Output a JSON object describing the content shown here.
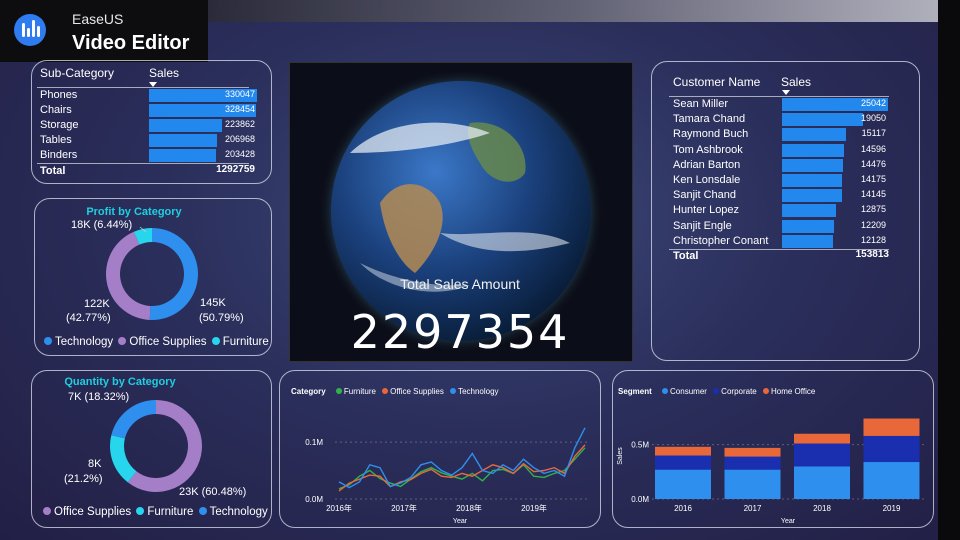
{
  "watermark": {
    "brand": "EaseUS",
    "app": "Video Editor"
  },
  "subcategory_table": {
    "col1": "Sub-Category",
    "col2": "Sales",
    "rows": [
      {
        "name": "Phones",
        "value": 330047
      },
      {
        "name": "Chairs",
        "value": 328454
      },
      {
        "name": "Storage",
        "value": 223862
      },
      {
        "name": "Tables",
        "value": 206968
      },
      {
        "name": "Binders",
        "value": 203428
      }
    ],
    "total_label": "Total",
    "total_value": "1292759"
  },
  "profit_by_category": {
    "title": "Profit by Category",
    "labels": {
      "furniture": "18K (6.44%)",
      "office_l1": "122K",
      "office_l2": "(42.77%)",
      "tech_l1": "145K",
      "tech_l2": "(50.79%)"
    },
    "legend": [
      "Technology",
      "Office Supplies",
      "Furniture"
    ],
    "values": [
      50.79,
      42.77,
      6.44
    ]
  },
  "quantity_by_category": {
    "title": "Quantity by Category",
    "labels": {
      "furniture": "7K (18.32%)",
      "tech_l1": "8K",
      "tech_l2": "(21.2%)",
      "office": "23K (60.48%)"
    },
    "legend": [
      "Office Supplies",
      "Furniture",
      "Technology"
    ],
    "values": [
      60.48,
      18.32,
      21.2
    ]
  },
  "kpi": {
    "label": "Total Sales Amount",
    "value": "2297354"
  },
  "customer_table": {
    "col1": "Customer Name",
    "col2": "Sales",
    "rows": [
      {
        "name": "Sean Miller",
        "value": 25042
      },
      {
        "name": "Tamara Chand",
        "value": 19050
      },
      {
        "name": "Raymond Buch",
        "value": 15117
      },
      {
        "name": "Tom Ashbrook",
        "value": 14596
      },
      {
        "name": "Adrian Barton",
        "value": 14476
      },
      {
        "name": "Ken Lonsdale",
        "value": 14175
      },
      {
        "name": "Sanjit Chand",
        "value": 14145
      },
      {
        "name": "Hunter Lopez",
        "value": 12875
      },
      {
        "name": "Sanjit Engle",
        "value": 12209
      },
      {
        "name": "Christopher Conant",
        "value": 12128
      }
    ],
    "total_label": "Total",
    "total_value": "153813"
  },
  "colors": {
    "technology": "#2e8fee",
    "office_supplies": "#a57ec8",
    "furniture": "#27d6ec",
    "consumer": "#2e8fee",
    "corporate": "#1a2fb0",
    "home_office": "#e8683a",
    "line_furniture": "#2fb34a",
    "line_office": "#e8683a",
    "line_tech": "#2e8fee"
  },
  "chart_data": [
    {
      "type": "line",
      "legend_title": "Category",
      "xlabel": "Year",
      "ylabel": "",
      "x_ticks": [
        "2016年",
        "2017年",
        "2018年",
        "2019年"
      ],
      "y_ticks": [
        "0.0M",
        "0.1M"
      ],
      "ylim": [
        0,
        0.13
      ],
      "series": [
        {
          "name": "Furniture",
          "values": [
            0.018,
            0.025,
            0.04,
            0.05,
            0.036,
            0.028,
            0.022,
            0.035,
            0.048,
            0.055,
            0.046,
            0.04,
            0.035,
            0.045,
            0.032,
            0.05,
            0.052,
            0.045,
            0.06,
            0.04,
            0.038,
            0.045,
            0.05,
            0.07,
            0.09
          ]
        },
        {
          "name": "Office Supplies",
          "values": [
            0.014,
            0.028,
            0.035,
            0.042,
            0.04,
            0.022,
            0.03,
            0.034,
            0.045,
            0.052,
            0.04,
            0.038,
            0.045,
            0.04,
            0.05,
            0.06,
            0.055,
            0.045,
            0.062,
            0.048,
            0.05,
            0.055,
            0.045,
            0.075,
            0.095
          ]
        },
        {
          "name": "Technology",
          "values": [
            0.03,
            0.02,
            0.03,
            0.06,
            0.055,
            0.022,
            0.028,
            0.038,
            0.06,
            0.065,
            0.05,
            0.042,
            0.055,
            0.08,
            0.05,
            0.045,
            0.06,
            0.05,
            0.07,
            0.055,
            0.045,
            0.05,
            0.04,
            0.09,
            0.125
          ]
        }
      ]
    },
    {
      "type": "bar",
      "stacked": true,
      "legend_title": "Segment",
      "xlabel": "Year",
      "ylabel": "Sales",
      "categories": [
        "2016",
        "2017",
        "2018",
        "2019"
      ],
      "y_ticks": [
        "0.0M",
        "0.5M"
      ],
      "ylim": [
        0,
        0.8
      ],
      "series": [
        {
          "name": "Consumer",
          "values": [
            0.27,
            0.27,
            0.3,
            0.34
          ]
        },
        {
          "name": "Corporate",
          "values": [
            0.13,
            0.12,
            0.21,
            0.24
          ]
        },
        {
          "name": "Home Office",
          "values": [
            0.08,
            0.08,
            0.09,
            0.16
          ]
        }
      ]
    }
  ]
}
